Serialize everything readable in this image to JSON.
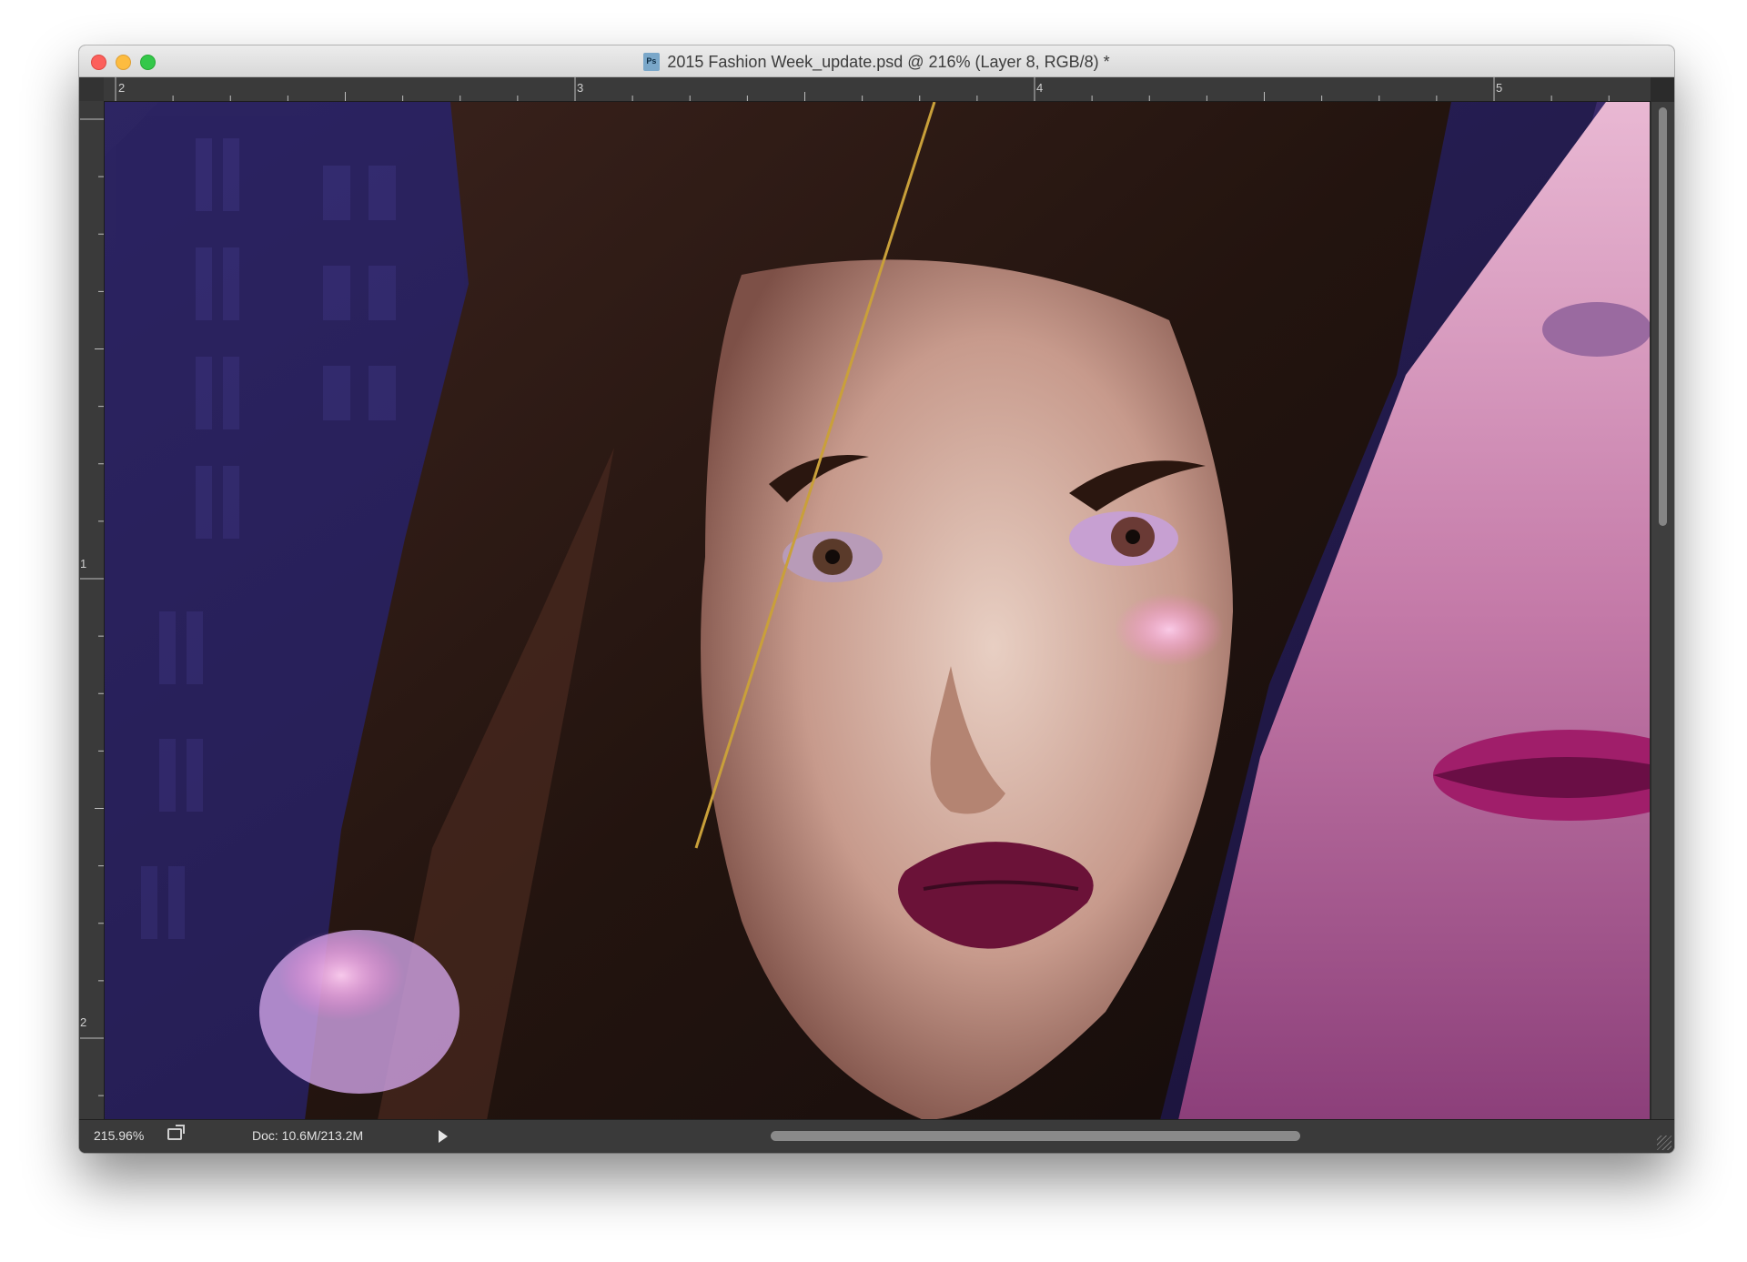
{
  "window": {
    "title": "2015 Fashion Week_update.psd @ 216% (Layer 8, RGB/8) *"
  },
  "rulers": {
    "horizontal_labels": [
      "2",
      "3",
      "4",
      "5"
    ],
    "vertical_labels": [
      "1",
      "2"
    ]
  },
  "status": {
    "zoom": "215.96%",
    "doc_info": "Doc: 10.6M/213.2M"
  },
  "colors": {
    "canvas_background": "#231c46",
    "guide_line": "#c9a03a",
    "lip_color": "#6b1238"
  },
  "icons": [
    "close-light",
    "minimize-light",
    "zoom-light",
    "psd-file-icon",
    "export-icon",
    "play-triangle-icon"
  ]
}
